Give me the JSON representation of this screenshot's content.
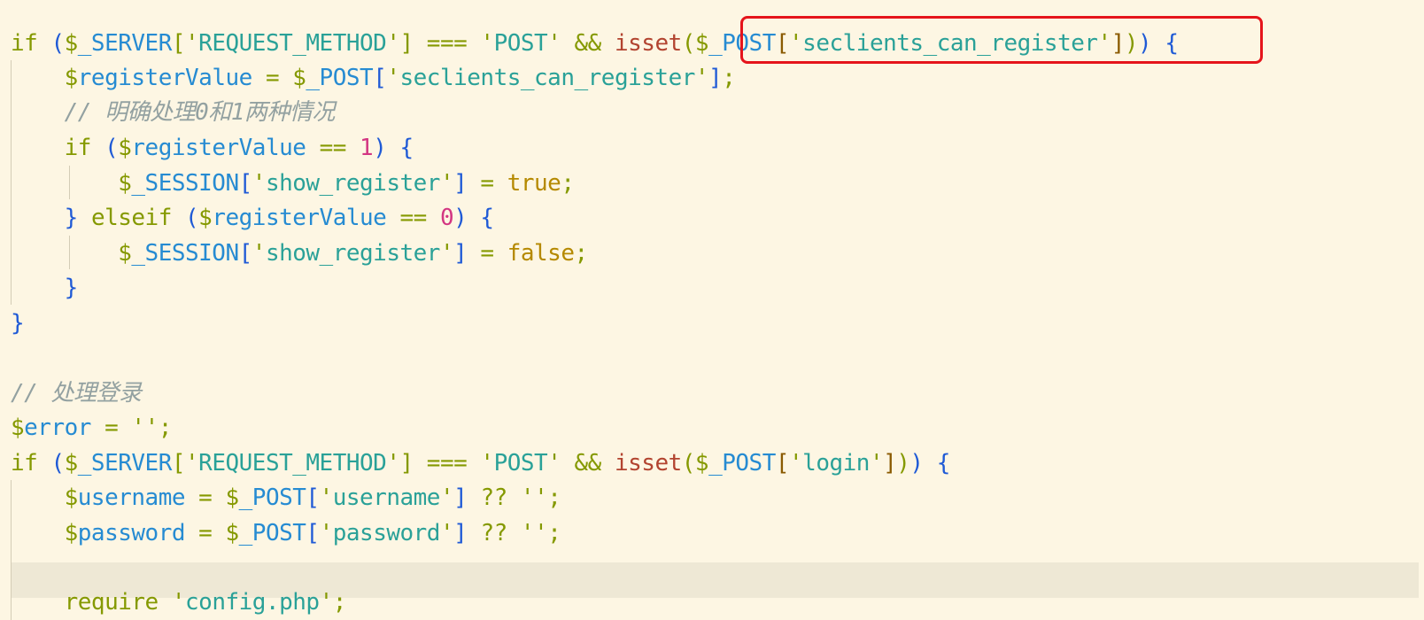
{
  "editor": {
    "theme_background": "#fdf6e3",
    "highlight_color": "#e5141b",
    "lines": [
      "if ($_SERVER['REQUEST_METHOD'] === 'POST' && isset($_POST['seclients_can_register'])) {",
      "    $registerValue = $_POST['seclients_can_register'];",
      "    // 明确处理0和1两种情况",
      "    if ($registerValue == 1) {",
      "        $_SESSION['show_register'] = true;",
      "    } elseif ($registerValue == 0) {",
      "        $_SESSION['show_register'] = false;",
      "    }",
      "}",
      "",
      "// 处理登录",
      "$error = '';",
      "if ($_SERVER['REQUEST_METHOD'] === 'POST' && isset($_POST['login'])) {",
      "    $username = $_POST['username'] ?? '';",
      "    $password = $_POST['password'] ?? '';",
      "",
      "    require 'config.php';"
    ],
    "highlighted_text": "($_POST['seclients_can_register']))"
  }
}
